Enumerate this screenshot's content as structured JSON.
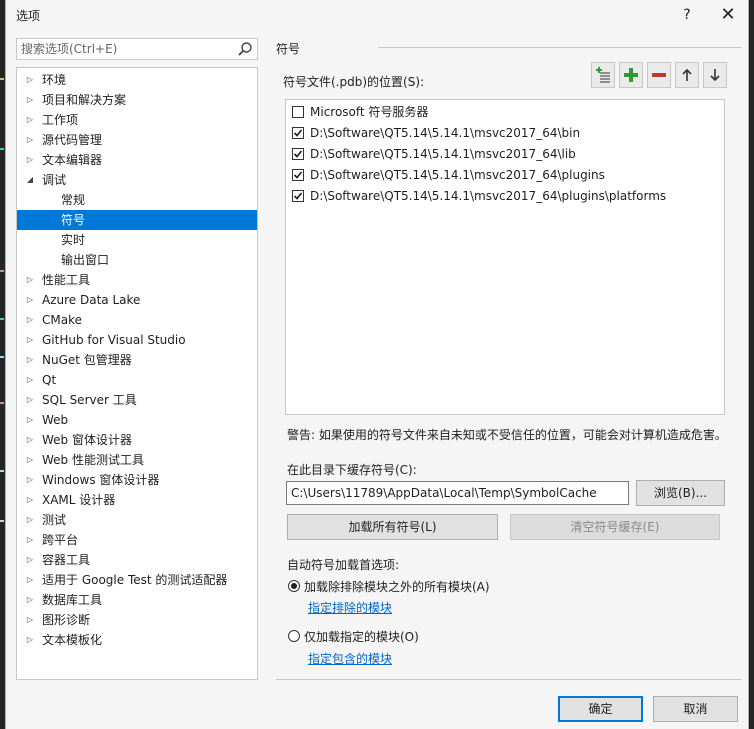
{
  "window": {
    "title": "选项",
    "help": "?",
    "close": "✕"
  },
  "search": {
    "placeholder": "搜索选项(Ctrl+E)"
  },
  "tree": [
    {
      "label": "环境",
      "level": 0,
      "arrow": "right",
      "selected": false
    },
    {
      "label": "项目和解决方案",
      "level": 0,
      "arrow": "right",
      "selected": false
    },
    {
      "label": "工作项",
      "level": 0,
      "arrow": "right",
      "selected": false
    },
    {
      "label": "源代码管理",
      "level": 0,
      "arrow": "right",
      "selected": false
    },
    {
      "label": "文本编辑器",
      "level": 0,
      "arrow": "right",
      "selected": false
    },
    {
      "label": "调试",
      "level": 0,
      "arrow": "down",
      "selected": false
    },
    {
      "label": "常规",
      "level": 1,
      "arrow": "none",
      "selected": false
    },
    {
      "label": "符号",
      "level": 1,
      "arrow": "none",
      "selected": true
    },
    {
      "label": "实时",
      "level": 1,
      "arrow": "none",
      "selected": false
    },
    {
      "label": "输出窗口",
      "level": 1,
      "arrow": "none",
      "selected": false
    },
    {
      "label": "性能工具",
      "level": 0,
      "arrow": "right",
      "selected": false
    },
    {
      "label": "Azure Data Lake",
      "level": 0,
      "arrow": "right",
      "selected": false
    },
    {
      "label": "CMake",
      "level": 0,
      "arrow": "right",
      "selected": false
    },
    {
      "label": "GitHub for Visual Studio",
      "level": 0,
      "arrow": "right",
      "selected": false
    },
    {
      "label": "NuGet 包管理器",
      "level": 0,
      "arrow": "right",
      "selected": false
    },
    {
      "label": "Qt",
      "level": 0,
      "arrow": "right",
      "selected": false
    },
    {
      "label": "SQL Server 工具",
      "level": 0,
      "arrow": "right",
      "selected": false
    },
    {
      "label": "Web",
      "level": 0,
      "arrow": "right",
      "selected": false
    },
    {
      "label": "Web 窗体设计器",
      "level": 0,
      "arrow": "right",
      "selected": false
    },
    {
      "label": "Web 性能测试工具",
      "level": 0,
      "arrow": "right",
      "selected": false
    },
    {
      "label": "Windows 窗体设计器",
      "level": 0,
      "arrow": "right",
      "selected": false
    },
    {
      "label": "XAML 设计器",
      "level": 0,
      "arrow": "right",
      "selected": false
    },
    {
      "label": "测试",
      "level": 0,
      "arrow": "right",
      "selected": false
    },
    {
      "label": "跨平台",
      "level": 0,
      "arrow": "right",
      "selected": false
    },
    {
      "label": "容器工具",
      "level": 0,
      "arrow": "right",
      "selected": false
    },
    {
      "label": "适用于 Google Test 的测试适配器",
      "level": 0,
      "arrow": "right",
      "selected": false
    },
    {
      "label": "数据库工具",
      "level": 0,
      "arrow": "right",
      "selected": false
    },
    {
      "label": "图形诊断",
      "level": 0,
      "arrow": "right",
      "selected": false
    },
    {
      "label": "文本模板化",
      "level": 0,
      "arrow": "right",
      "selected": false
    }
  ],
  "symbols": {
    "section_title": "符号",
    "locations_label": "符号文件(.pdb)的位置(S):",
    "locations": [
      {
        "checked": false,
        "label": "Microsoft 符号服务器"
      },
      {
        "checked": true,
        "label": "D:\\Software\\QT5.14\\5.14.1\\msvc2017_64\\bin"
      },
      {
        "checked": true,
        "label": "D:\\Software\\QT5.14\\5.14.1\\msvc2017_64\\lib"
      },
      {
        "checked": true,
        "label": "D:\\Software\\QT5.14\\5.14.1\\msvc2017_64\\plugins"
      },
      {
        "checked": true,
        "label": "D:\\Software\\QT5.14\\5.14.1\\msvc2017_64\\plugins\\platforms"
      }
    ],
    "warning": "警告: 如果使用的符号文件来自未知或不受信任的位置，可能会对计算机造成危害。",
    "cache_label": "在此目录下缓存符号(C):",
    "cache_value": "C:\\Users\\11789\\AppData\\Local\\Temp\\SymbolCache",
    "browse": "浏览(B)...",
    "load_all": "加载所有符号(L)",
    "clear_cache": "清空符号缓存(E)",
    "auto_label": "自动符号加载首选项:",
    "radio_all": "加载除排除模块之外的所有模块(A)",
    "link_excluded": "指定排除的模块",
    "radio_specified": "仅加载指定的模块(O)",
    "link_included": "指定包含的模块"
  },
  "footer": {
    "ok": "确定",
    "cancel": "取消"
  },
  "colors": {
    "accent": "#0078d7",
    "add": "#2e9b2e",
    "remove": "#c0392b"
  }
}
